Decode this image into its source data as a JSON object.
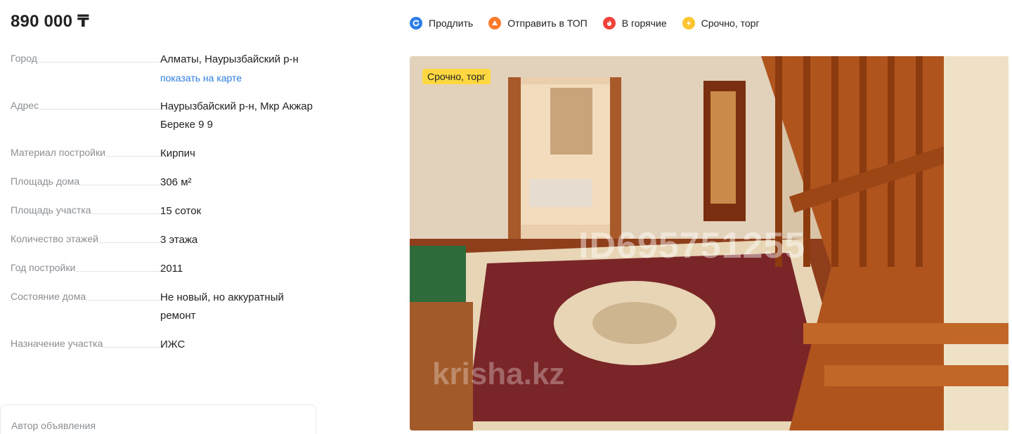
{
  "price": "890 000 ₸",
  "services": [
    {
      "label": "Продлить",
      "color": "#2b7de9",
      "icon": "refresh-icon"
    },
    {
      "label": "Отправить в ТОП",
      "color": "#ff7a2d",
      "icon": "up-arrow-icon"
    },
    {
      "label": "В горячие",
      "color": "#f3413a",
      "icon": "flame-icon"
    },
    {
      "label": "Срочно, торг",
      "color": "#ffc42e",
      "icon": "lightning-icon"
    }
  ],
  "params": [
    {
      "label": "Город",
      "value": "Алматы, Наурызбайский р-н",
      "link": "показать на карте"
    },
    {
      "label": "Адрес",
      "value": "Наурызбайский р-н, Мкр Акжар Береке 9 9"
    },
    {
      "label": "Материал постройки",
      "value": "Кирпич"
    },
    {
      "label": "Площадь дома",
      "value": "306 м²"
    },
    {
      "label": "Площадь участка",
      "value": "15 соток"
    },
    {
      "label": "Количество этажей",
      "value": "3 этажа"
    },
    {
      "label": "Год постройки",
      "value": "2011"
    },
    {
      "label": "Состояние дома",
      "value": "Не новый, но аккуратный ремонт"
    },
    {
      "label": "Назначение участка",
      "value": "ИЖС"
    }
  ],
  "author_title": "Автор объявления",
  "photo": {
    "badge": "Срочно, торг",
    "watermark_id": "ID695751255",
    "watermark_site": "krisha.kz"
  }
}
